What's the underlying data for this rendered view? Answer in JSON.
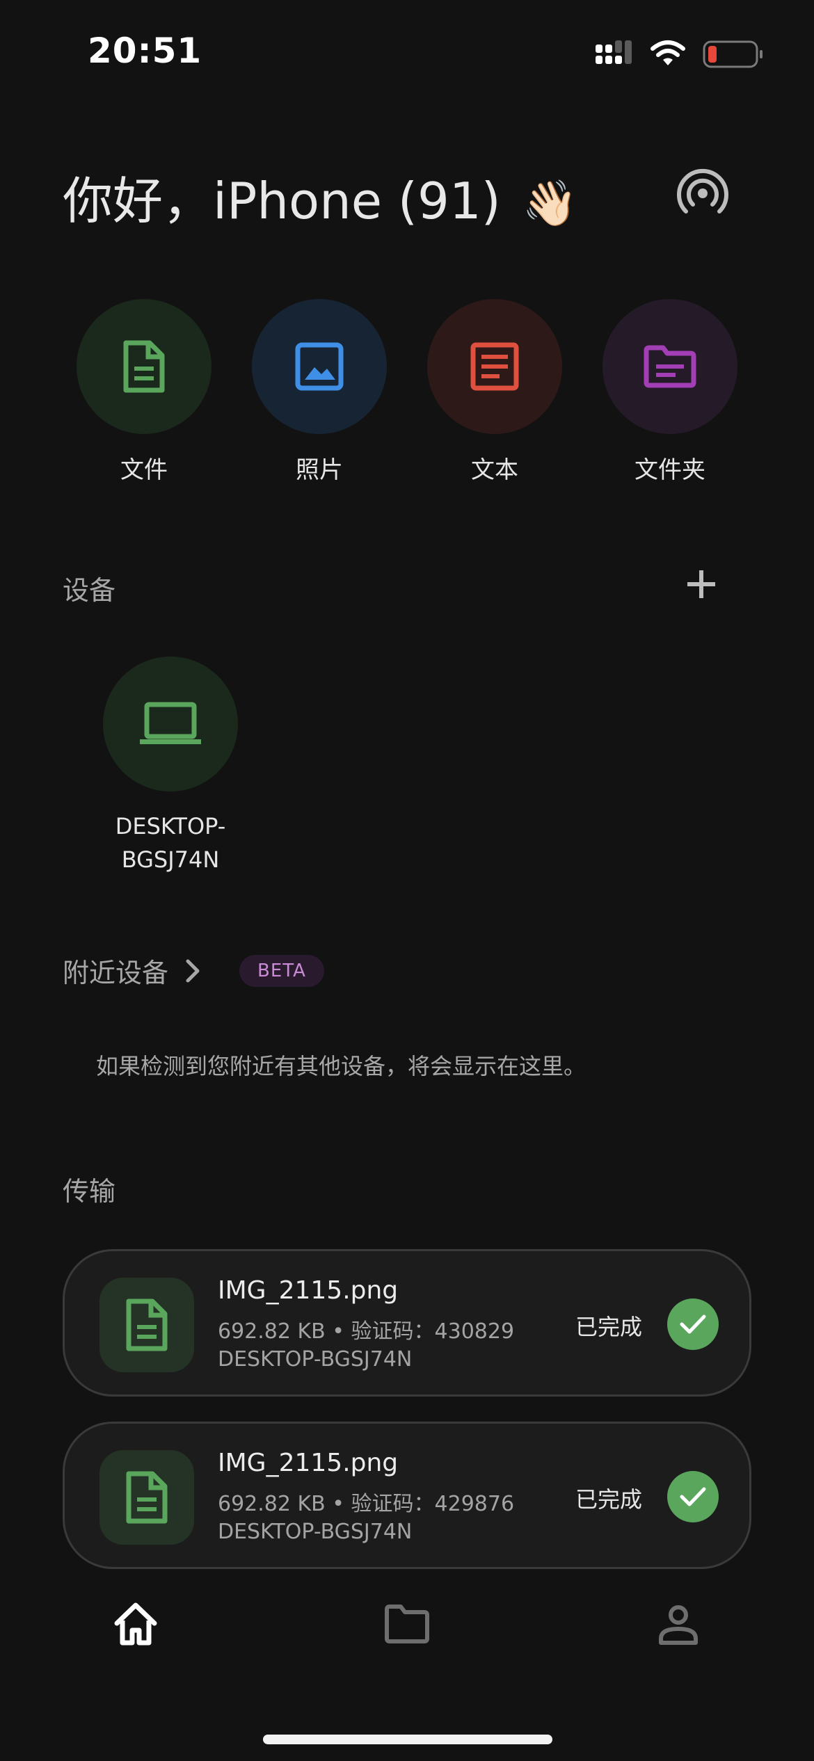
{
  "status_bar": {
    "time": "20:51",
    "icons": [
      "signal-icon",
      "wifi-icon",
      "battery-icon"
    ],
    "battery_color": "#e5483b"
  },
  "header": {
    "greeting": "你好，iPhone (91)",
    "wave_emoji": "👋🏻",
    "broadcast_icon": "broadcast-icon"
  },
  "actions": [
    {
      "label": "文件",
      "icon": "file-icon",
      "color": "#5aa65d",
      "bg": "#1b281c"
    },
    {
      "label": "照片",
      "icon": "image-icon",
      "color": "#3f8fe6",
      "bg": "#172433"
    },
    {
      "label": "文本",
      "icon": "text-icon",
      "color": "#e0503e",
      "bg": "#2d1a18"
    },
    {
      "label": "文件夹",
      "icon": "folder-icon",
      "color": "#a23fb5",
      "bg": "#251a28"
    }
  ],
  "devices": {
    "title": "设备",
    "add_icon": "plus-icon",
    "items": [
      {
        "name_line1": "DESKTOP-",
        "name_line2": "BGSJ74N",
        "icon": "laptop-icon"
      }
    ]
  },
  "nearby": {
    "title": "附近设备",
    "badge": "BETA",
    "hint": "如果检测到您附近有其他设备，将会显示在这里。"
  },
  "transfers": {
    "title": "传输",
    "items": [
      {
        "filename": "IMG_2115.png",
        "details": "692.82 KB • 验证码：430829",
        "device": "DESKTOP-BGSJ74N",
        "status": "已完成"
      },
      {
        "filename": "IMG_2115.png",
        "details": "692.82 KB • 验证码：429876",
        "device": "DESKTOP-BGSJ74N",
        "status": "已完成"
      }
    ]
  },
  "bottom_nav": [
    {
      "icon": "home-icon",
      "active": true
    },
    {
      "icon": "folder-icon",
      "active": false
    },
    {
      "icon": "person-icon",
      "active": false
    }
  ]
}
